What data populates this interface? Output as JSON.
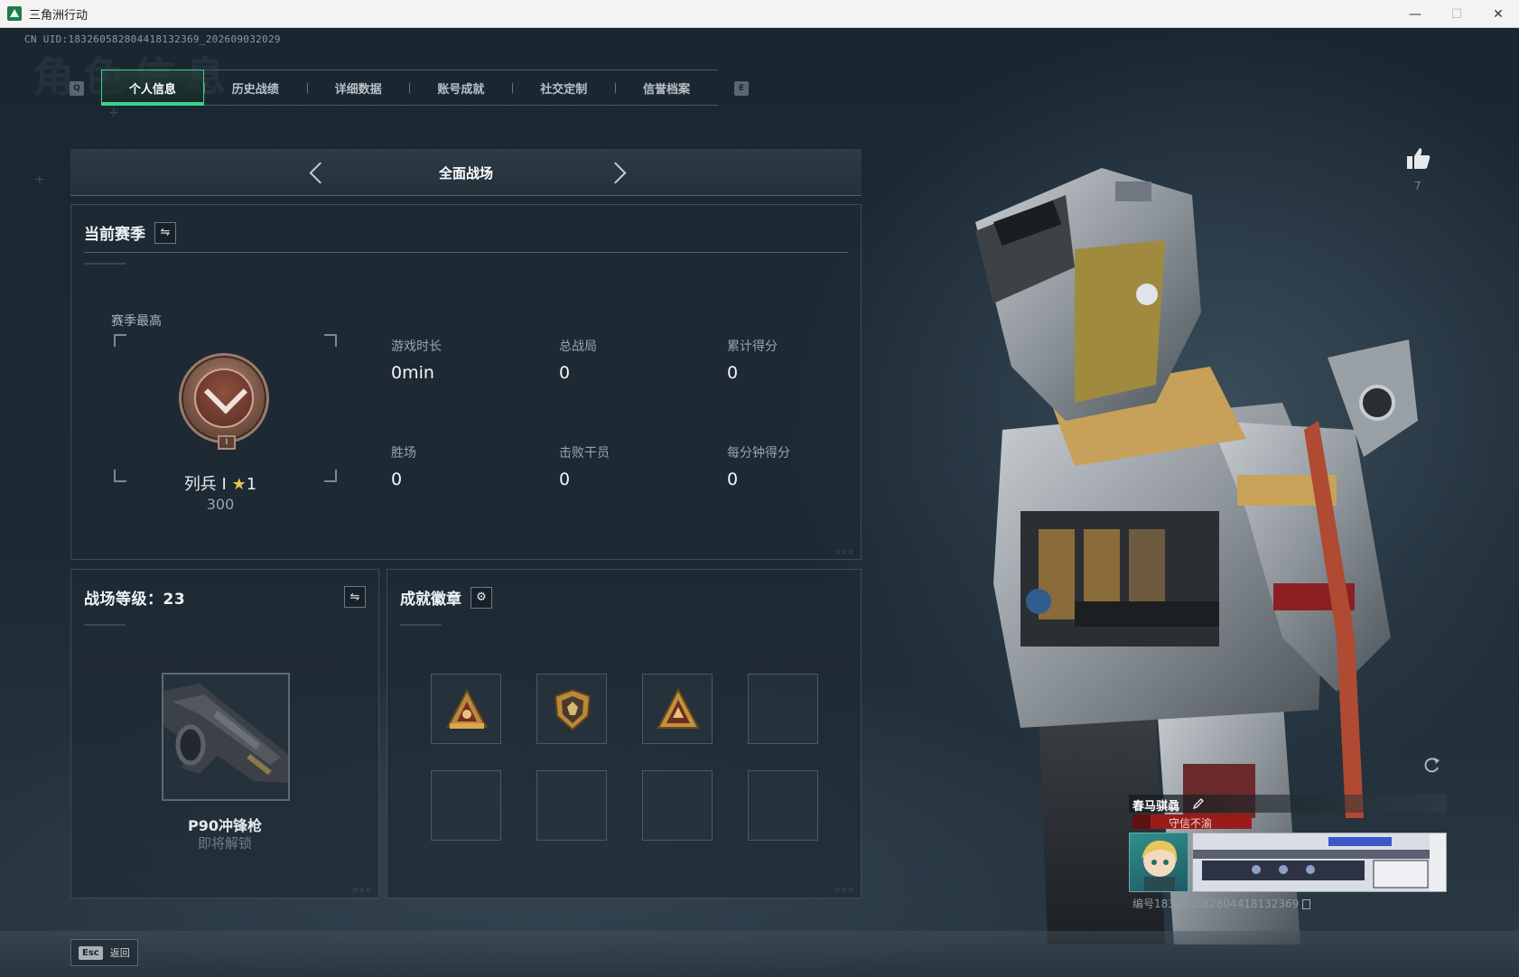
{
  "window": {
    "title": "三角洲行动",
    "controls": {
      "minimize": "—",
      "maximize": "☐",
      "close": "✕"
    }
  },
  "uid": "CN UID:18326058280441813236​9_202609032029",
  "bg_title": "角色信息",
  "tabs": {
    "key_left": "Q",
    "key_right": "E",
    "items": [
      {
        "label": "个人信息",
        "active": true
      },
      {
        "label": "历史战绩",
        "active": false
      },
      {
        "label": "详细数据",
        "active": false
      },
      {
        "label": "账号成就",
        "active": false
      },
      {
        "label": "社交定制",
        "active": false
      },
      {
        "label": "信誉档案",
        "active": false
      }
    ]
  },
  "mode": {
    "title": "全面战场"
  },
  "season": {
    "title": "当前赛季",
    "best_label": "赛季最高",
    "rank_name": "列兵 I",
    "rank_stars": "1",
    "rank_points": "300",
    "badge_numeral": "I",
    "stats": [
      {
        "label": "游戏时长",
        "value": "0min"
      },
      {
        "label": "总战局",
        "value": "0"
      },
      {
        "label": "累计得分",
        "value": "0"
      },
      {
        "label": "胜场",
        "value": "0"
      },
      {
        "label": "击败干员",
        "value": "0"
      },
      {
        "label": "每分钟得分",
        "value": "0"
      }
    ]
  },
  "level": {
    "title": "战场等级：23",
    "weapon_name": "P90冲锋枪",
    "weapon_status": "即将解锁"
  },
  "achievements": {
    "title": "成就徽章",
    "slots": [
      {
        "icon": "gold-triangle-crest-icon",
        "filled": true
      },
      {
        "icon": "gold-shield-badge-icon",
        "filled": true
      },
      {
        "icon": "gold-triangle-badge-icon",
        "filled": true
      },
      {
        "icon": "",
        "filled": false
      },
      {
        "icon": "",
        "filled": false
      },
      {
        "icon": "",
        "filled": false
      },
      {
        "icon": "",
        "filled": false
      },
      {
        "icon": "",
        "filled": false
      }
    ]
  },
  "likes": {
    "count": "7"
  },
  "card": {
    "player_name": "春马骐骉",
    "motto": "守信不渝",
    "card_id": "编号183260582804418132369"
  },
  "bottom": {
    "esc_key": "Esc",
    "esc_label": "返回"
  },
  "colors": {
    "accent": "#3fcf8e",
    "rank_star": "#e6c44f",
    "motto_red": "#9b1b1b"
  }
}
